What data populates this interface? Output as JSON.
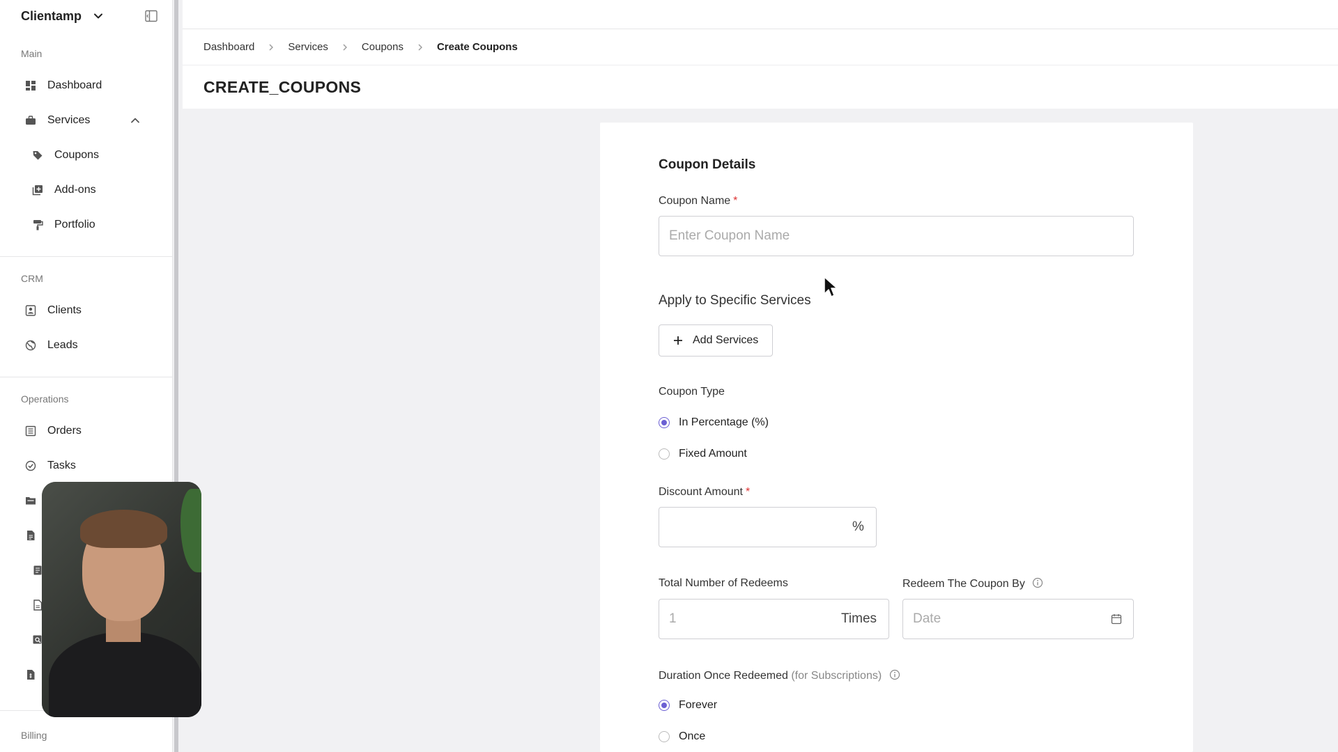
{
  "sidebar": {
    "app_name": "Clientamp",
    "sections": {
      "main": "Main",
      "crm": "CRM",
      "operations": "Operations",
      "billing": "Billing"
    },
    "items": {
      "dashboard": "Dashboard",
      "services": "Services",
      "coupons": "Coupons",
      "addons": "Add-ons",
      "portfolio": "Portfolio",
      "clients": "Clients",
      "leads": "Leads",
      "orders": "Orders",
      "tasks": "Tasks"
    }
  },
  "breadcrumb": [
    "Dashboard",
    "Services",
    "Coupons",
    "Create Coupons"
  ],
  "page_title": "CREATE_COUPONS",
  "form": {
    "section_title": "Coupon Details",
    "coupon_name": {
      "label": "Coupon Name",
      "required_mark": "*",
      "placeholder": "Enter Coupon Name",
      "value": ""
    },
    "apply_services": {
      "label": "Apply to Specific Services",
      "button": "Add Services"
    },
    "coupon_type": {
      "label": "Coupon Type",
      "options": [
        "In Percentage (%)",
        "Fixed Amount"
      ],
      "selected": "In Percentage (%)"
    },
    "discount_amount": {
      "label": "Discount Amount",
      "required_mark": "*",
      "value": "",
      "suffix": "%"
    },
    "total_redeems": {
      "label": "Total Number of Redeems",
      "placeholder": "1",
      "suffix": "Times"
    },
    "redeem_by": {
      "label": "Redeem The Coupon By",
      "placeholder": "Date"
    },
    "duration": {
      "label": "Duration Once Redeemed",
      "label_note": "(for Subscriptions)",
      "options": [
        "Forever",
        "Once"
      ],
      "selected": "Forever"
    }
  },
  "colors": {
    "accent": "#6b5fd3",
    "required": "#dd3333",
    "background": "#f1f1f3"
  }
}
